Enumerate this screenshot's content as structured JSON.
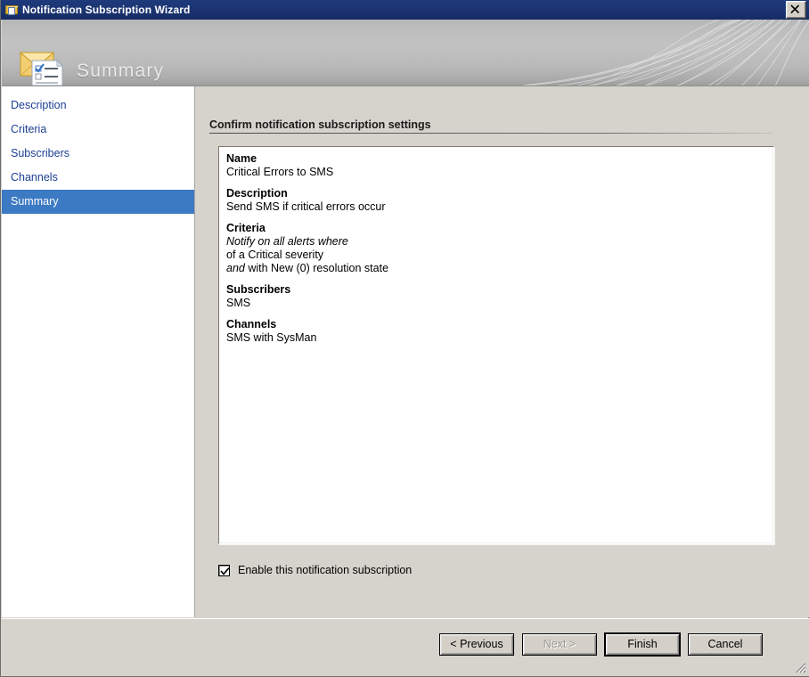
{
  "window": {
    "title": "Notification Subscription Wizard",
    "title_icon": "envelope-document-icon",
    "close_label": "✕"
  },
  "banner": {
    "title": "Summary",
    "icon": "envelope-checklist-icon"
  },
  "sidebar": {
    "items": [
      {
        "label": "Description",
        "selected": false
      },
      {
        "label": "Criteria",
        "selected": false
      },
      {
        "label": "Subscribers",
        "selected": false
      },
      {
        "label": "Channels",
        "selected": false
      },
      {
        "label": "Summary",
        "selected": true
      }
    ]
  },
  "content": {
    "heading": "Confirm notification subscription settings",
    "summary": [
      {
        "heading": "Name",
        "lines": [
          [
            {
              "text": "Critical Errors to SMS",
              "italic": false
            }
          ]
        ]
      },
      {
        "heading": "Description",
        "lines": [
          [
            {
              "text": "Send SMS if critical errors occur",
              "italic": false
            }
          ]
        ]
      },
      {
        "heading": "Criteria",
        "lines": [
          [
            {
              "text": "Notify on all alerts where",
              "italic": true
            }
          ],
          [
            {
              "text": " of a Critical severity",
              "italic": false
            }
          ],
          [
            {
              "text": "and",
              "italic": true
            },
            {
              "text": " with New (0) resolution state",
              "italic": false
            }
          ]
        ]
      },
      {
        "heading": "Subscribers",
        "lines": [
          [
            {
              "text": "SMS",
              "italic": false
            }
          ]
        ]
      },
      {
        "heading": "Channels",
        "lines": [
          [
            {
              "text": "SMS with SysMan",
              "italic": false
            }
          ]
        ]
      }
    ],
    "enable_checkbox": {
      "label": "Enable this notification subscription",
      "checked": true
    }
  },
  "footer": {
    "buttons": [
      {
        "label": "< Previous",
        "state": "enabled"
      },
      {
        "label": "Next >",
        "state": "disabled"
      },
      {
        "label": "Finish",
        "state": "default"
      },
      {
        "label": "Cancel",
        "state": "enabled"
      }
    ]
  },
  "colors": {
    "titlebar": "#1b3472",
    "selection": "#3c7ac4",
    "nav_link": "#1c3f94",
    "dialog_face": "#d6d3cd"
  }
}
